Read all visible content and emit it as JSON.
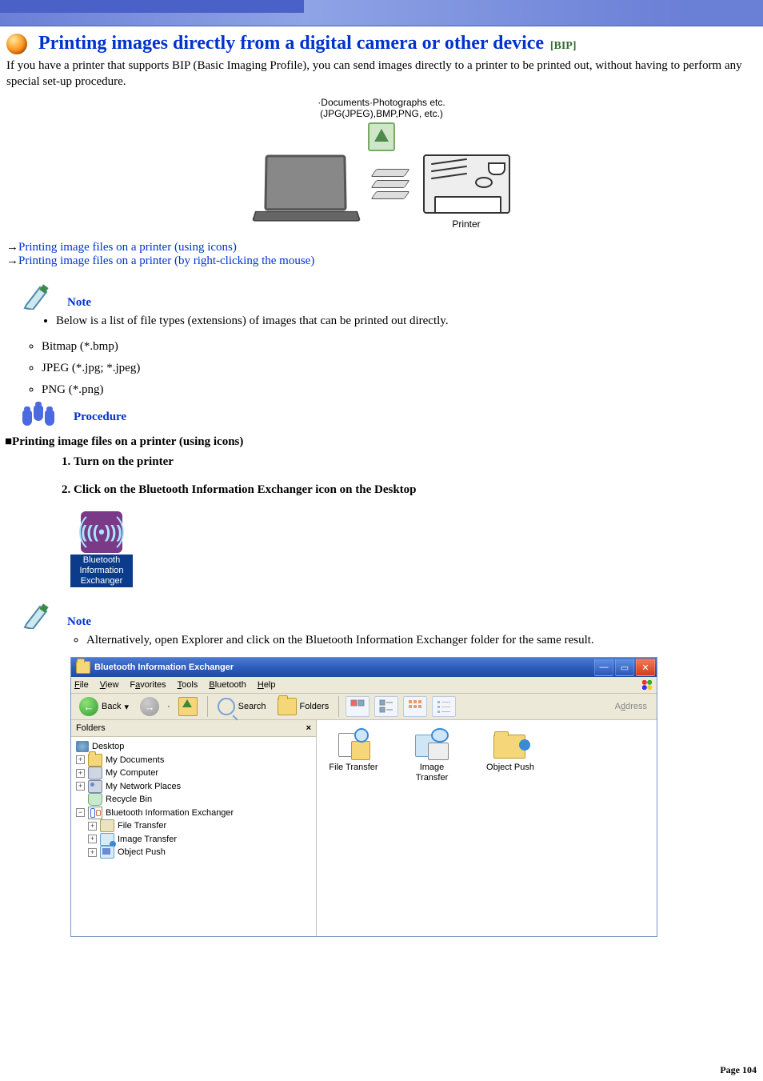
{
  "header": {
    "title": "Printing images directly from a digital camera or other device",
    "bip_tag": "[BIP]"
  },
  "intro": "If you have a printer that supports BIP (Basic Imaging Profile), you can send images directly to a printer to be printed out, without having to perform any special set-up procedure.",
  "diagram": {
    "top_line1": "·Documents·Photographs etc.",
    "top_line2": "(JPG(JPEG),BMP,PNG, etc.)",
    "printer_label": "Printer"
  },
  "links": {
    "l1": "Printing image files on a printer (using icons)",
    "l2": "Printing image files on a printer (by right-clicking the mouse)"
  },
  "note_label": "Note",
  "note_intro": "Below is a list of file types (extensions) of images that can be printed out directly.",
  "file_types": [
    "Bitmap (*.bmp)",
    "JPEG (*.jpg; *.jpeg)",
    "PNG (*.png)"
  ],
  "procedure_label": "Procedure",
  "section_a": "■Printing image files on a printer (using icons)",
  "steps": {
    "s1": "Turn on the printer",
    "s2": "Click on the Bluetooth Information Exchanger icon on the Desktop"
  },
  "shortcut": {
    "line1": "Bluetooth",
    "line2": "Information",
    "line3": "Exchanger"
  },
  "note2": "Alternatively, open Explorer and click on the Bluetooth Information Exchanger folder for the same result.",
  "explorer": {
    "title": "Bluetooth Information Exchanger",
    "menus": {
      "file": "File",
      "view": "View",
      "fav": "Favorites",
      "tools": "Tools",
      "bt": "Bluetooth",
      "help": "Help"
    },
    "toolbar": {
      "back": "Back",
      "search": "Search",
      "folders": "Folders",
      "address": "Address"
    },
    "pane_title": "Folders",
    "tree": {
      "desktop": "Desktop",
      "mydocs": "My Documents",
      "mycomp": "My Computer",
      "mynet": "My Network Places",
      "recycle": "Recycle Bin",
      "bie": "Bluetooth Information Exchanger",
      "ft": "File Transfer",
      "it": "Image Transfer",
      "op": "Object Push"
    },
    "items": {
      "ft": "File Transfer",
      "it": "Image\nTransfer",
      "op": "Object Push"
    }
  },
  "page_number": "Page 104"
}
